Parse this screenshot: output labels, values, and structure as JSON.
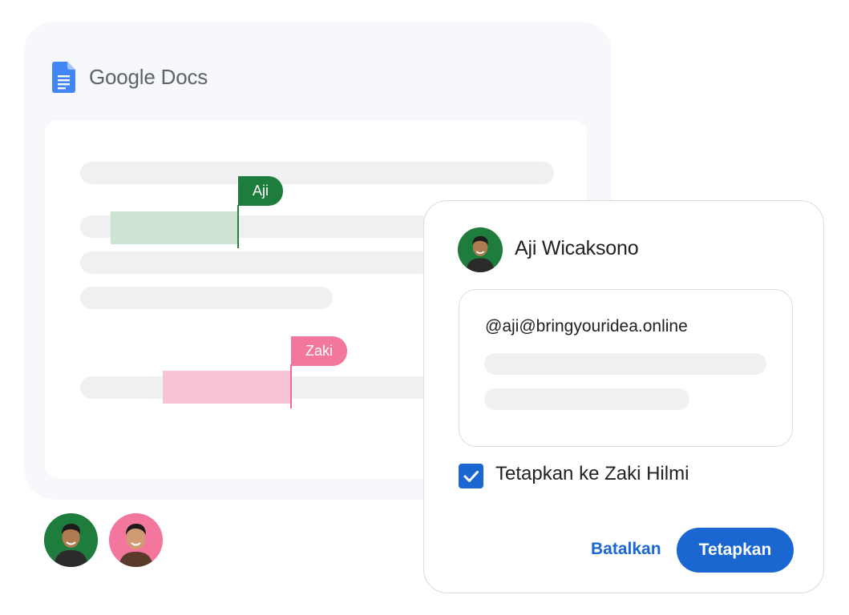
{
  "app": {
    "name": "Google Docs",
    "icon": "docs-icon"
  },
  "document": {
    "cursors": [
      {
        "user": "Aji",
        "color": "#1e7c3d"
      },
      {
        "user": "Zaki",
        "color": "#f3779c"
      }
    ]
  },
  "collaborators": [
    {
      "name": "Aji",
      "ring_color": "#1e7c3d"
    },
    {
      "name": "Zaki",
      "ring_color": "#f3779c"
    }
  ],
  "dialog": {
    "author_name": "Aji Wicaksono",
    "mention_text": "@aji@bringyouridea.online",
    "assign_checkbox": {
      "label": "Tetapkan ke Zaki Hilmi",
      "checked": true
    },
    "cancel_label": "Batalkan",
    "assign_label": "Tetapkan"
  },
  "colors": {
    "accent": "#1a67d2",
    "card_bg": "#f7f8fb",
    "line_placeholder": "#eff0f2"
  }
}
